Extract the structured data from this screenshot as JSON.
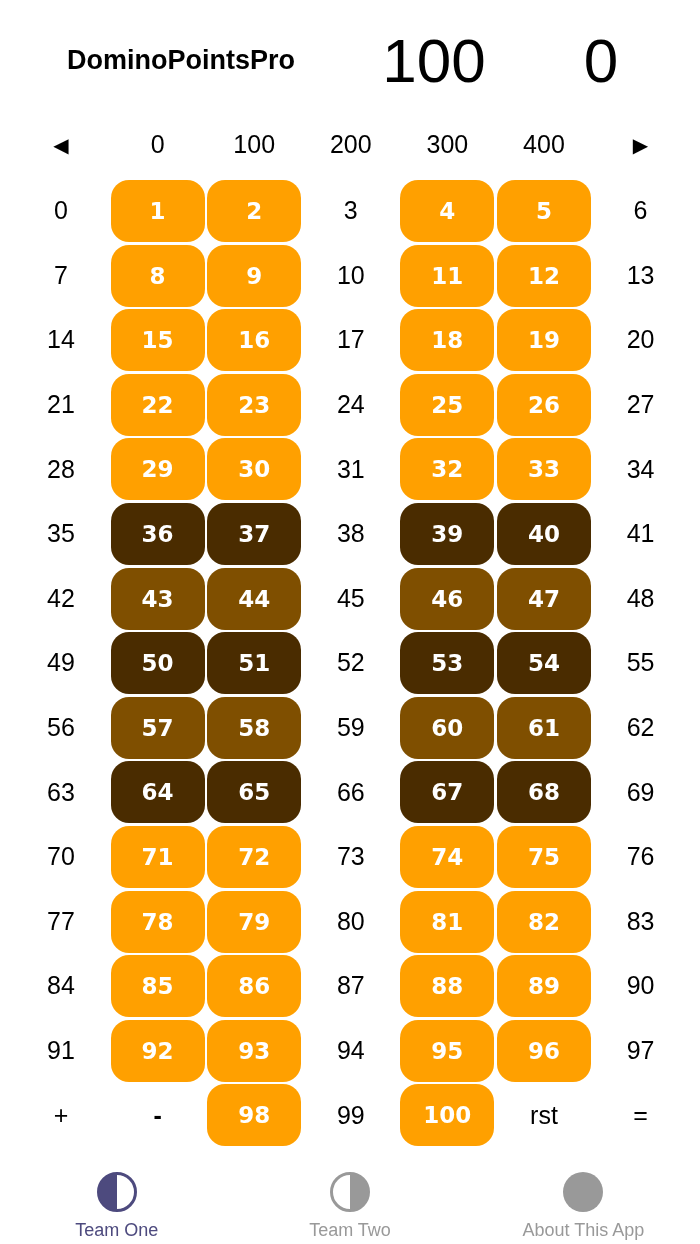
{
  "header": {
    "title": "DominoPointsPro",
    "scores": [
      "100",
      "0"
    ]
  },
  "top_row": [
    {
      "label": "◀",
      "kind": "arrow"
    },
    {
      "label": "0",
      "kind": "plain"
    },
    {
      "label": "100",
      "kind": "plain"
    },
    {
      "label": "200",
      "kind": "plain"
    },
    {
      "label": "300",
      "kind": "plain"
    },
    {
      "label": "400",
      "kind": "plain"
    },
    {
      "label": "▶",
      "kind": "arrow"
    }
  ],
  "grid": {
    "rows": [
      {
        "cells": [
          {
            "label": "0",
            "kind": "plain"
          },
          {
            "label": "1",
            "kind": "tile",
            "color": "#ffa000"
          },
          {
            "label": "2",
            "kind": "tile",
            "color": "#ffa000"
          },
          {
            "label": "3",
            "kind": "plain"
          },
          {
            "label": "4",
            "kind": "tile",
            "color": "#ffa000"
          },
          {
            "label": "5",
            "kind": "tile",
            "color": "#ffa000"
          },
          {
            "label": "6",
            "kind": "plain"
          }
        ]
      },
      {
        "cells": [
          {
            "label": "7",
            "kind": "plain"
          },
          {
            "label": "8",
            "kind": "tile",
            "color": "#ffa000"
          },
          {
            "label": "9",
            "kind": "tile",
            "color": "#ffa000"
          },
          {
            "label": "10",
            "kind": "plain"
          },
          {
            "label": "11",
            "kind": "tile",
            "color": "#ffa000"
          },
          {
            "label": "12",
            "kind": "tile",
            "color": "#ffa000"
          },
          {
            "label": "13",
            "kind": "plain"
          }
        ]
      },
      {
        "cells": [
          {
            "label": "14",
            "kind": "plain"
          },
          {
            "label": "15",
            "kind": "tile",
            "color": "#ffa000"
          },
          {
            "label": "16",
            "kind": "tile",
            "color": "#ffa000"
          },
          {
            "label": "17",
            "kind": "plain"
          },
          {
            "label": "18",
            "kind": "tile",
            "color": "#ffa000"
          },
          {
            "label": "19",
            "kind": "tile",
            "color": "#ffa000"
          },
          {
            "label": "20",
            "kind": "plain"
          }
        ]
      },
      {
        "cells": [
          {
            "label": "21",
            "kind": "plain"
          },
          {
            "label": "22",
            "kind": "tile",
            "color": "#ffa000"
          },
          {
            "label": "23",
            "kind": "tile",
            "color": "#ffa000"
          },
          {
            "label": "24",
            "kind": "plain"
          },
          {
            "label": "25",
            "kind": "tile",
            "color": "#ffa000"
          },
          {
            "label": "26",
            "kind": "tile",
            "color": "#ffa000"
          },
          {
            "label": "27",
            "kind": "plain"
          }
        ]
      },
      {
        "cells": [
          {
            "label": "28",
            "kind": "plain"
          },
          {
            "label": "29",
            "kind": "tile",
            "color": "#ffa000"
          },
          {
            "label": "30",
            "kind": "tile",
            "color": "#ffa000"
          },
          {
            "label": "31",
            "kind": "plain"
          },
          {
            "label": "32",
            "kind": "tile",
            "color": "#ffa000"
          },
          {
            "label": "33",
            "kind": "tile",
            "color": "#ffa000"
          },
          {
            "label": "34",
            "kind": "plain"
          }
        ]
      },
      {
        "cells": [
          {
            "label": "35",
            "kind": "plain"
          },
          {
            "label": "36",
            "kind": "tile",
            "color": "#4a2c00"
          },
          {
            "label": "37",
            "kind": "tile",
            "color": "#4a2c00"
          },
          {
            "label": "38",
            "kind": "plain"
          },
          {
            "label": "39",
            "kind": "tile",
            "color": "#4a2c00"
          },
          {
            "label": "40",
            "kind": "tile",
            "color": "#4a2c00"
          },
          {
            "label": "41",
            "kind": "plain"
          }
        ]
      },
      {
        "cells": [
          {
            "label": "42",
            "kind": "plain"
          },
          {
            "label": "43",
            "kind": "tile",
            "color": "#7f4f00"
          },
          {
            "label": "44",
            "kind": "tile",
            "color": "#7f4f00"
          },
          {
            "label": "45",
            "kind": "plain"
          },
          {
            "label": "46",
            "kind": "tile",
            "color": "#7f4f00"
          },
          {
            "label": "47",
            "kind": "tile",
            "color": "#7f4f00"
          },
          {
            "label": "48",
            "kind": "plain"
          }
        ]
      },
      {
        "cells": [
          {
            "label": "49",
            "kind": "plain"
          },
          {
            "label": "50",
            "kind": "tile",
            "color": "#4a2c00"
          },
          {
            "label": "51",
            "kind": "tile",
            "color": "#4a2c00"
          },
          {
            "label": "52",
            "kind": "plain"
          },
          {
            "label": "53",
            "kind": "tile",
            "color": "#4a2c00"
          },
          {
            "label": "54",
            "kind": "tile",
            "color": "#4a2c00"
          },
          {
            "label": "55",
            "kind": "plain"
          }
        ]
      },
      {
        "cells": [
          {
            "label": "56",
            "kind": "plain"
          },
          {
            "label": "57",
            "kind": "tile",
            "color": "#7f4f00"
          },
          {
            "label": "58",
            "kind": "tile",
            "color": "#7f4f00"
          },
          {
            "label": "59",
            "kind": "plain"
          },
          {
            "label": "60",
            "kind": "tile",
            "color": "#7f4f00"
          },
          {
            "label": "61",
            "kind": "tile",
            "color": "#7f4f00"
          },
          {
            "label": "62",
            "kind": "plain"
          }
        ]
      },
      {
        "cells": [
          {
            "label": "63",
            "kind": "plain"
          },
          {
            "label": "64",
            "kind": "tile",
            "color": "#4a2c00"
          },
          {
            "label": "65",
            "kind": "tile",
            "color": "#4a2c00"
          },
          {
            "label": "66",
            "kind": "plain"
          },
          {
            "label": "67",
            "kind": "tile",
            "color": "#4a2c00"
          },
          {
            "label": "68",
            "kind": "tile",
            "color": "#4a2c00"
          },
          {
            "label": "69",
            "kind": "plain"
          }
        ]
      },
      {
        "cells": [
          {
            "label": "70",
            "kind": "plain"
          },
          {
            "label": "71",
            "kind": "tile",
            "color": "#ffa000"
          },
          {
            "label": "72",
            "kind": "tile",
            "color": "#ffa000"
          },
          {
            "label": "73",
            "kind": "plain"
          },
          {
            "label": "74",
            "kind": "tile",
            "color": "#ffa000"
          },
          {
            "label": "75",
            "kind": "tile",
            "color": "#ffa000"
          },
          {
            "label": "76",
            "kind": "plain"
          }
        ]
      },
      {
        "cells": [
          {
            "label": "77",
            "kind": "plain"
          },
          {
            "label": "78",
            "kind": "tile",
            "color": "#ffa000"
          },
          {
            "label": "79",
            "kind": "tile",
            "color": "#ffa000"
          },
          {
            "label": "80",
            "kind": "plain"
          },
          {
            "label": "81",
            "kind": "tile",
            "color": "#ffa000"
          },
          {
            "label": "82",
            "kind": "tile",
            "color": "#ffa000"
          },
          {
            "label": "83",
            "kind": "plain"
          }
        ]
      },
      {
        "cells": [
          {
            "label": "84",
            "kind": "plain"
          },
          {
            "label": "85",
            "kind": "tile",
            "color": "#ffa000"
          },
          {
            "label": "86",
            "kind": "tile",
            "color": "#ffa000"
          },
          {
            "label": "87",
            "kind": "plain"
          },
          {
            "label": "88",
            "kind": "tile",
            "color": "#ffa000"
          },
          {
            "label": "89",
            "kind": "tile",
            "color": "#ffa000"
          },
          {
            "label": "90",
            "kind": "plain"
          }
        ]
      },
      {
        "cells": [
          {
            "label": "91",
            "kind": "plain"
          },
          {
            "label": "92",
            "kind": "tile",
            "color": "#ffa000"
          },
          {
            "label": "93",
            "kind": "tile",
            "color": "#ffa000"
          },
          {
            "label": "94",
            "kind": "plain"
          },
          {
            "label": "95",
            "kind": "tile",
            "color": "#ffa000"
          },
          {
            "label": "96",
            "kind": "tile",
            "color": "#ffa000"
          },
          {
            "label": "97",
            "kind": "plain"
          }
        ]
      },
      {
        "cells": [
          {
            "label": "+",
            "kind": "plain"
          },
          {
            "label": "-",
            "kind": "bold"
          },
          {
            "label": "98",
            "kind": "tile",
            "color": "#ffa000"
          },
          {
            "label": "99",
            "kind": "plain"
          },
          {
            "label": "100",
            "kind": "tile",
            "color": "#ffa000"
          },
          {
            "label": "rst",
            "kind": "plain"
          },
          {
            "label": "=",
            "kind": "plain"
          }
        ]
      }
    ]
  },
  "tabs": [
    {
      "label": "Team One",
      "kind": "left-half",
      "selected": true
    },
    {
      "label": "Team Two",
      "kind": "right-half",
      "selected": false
    },
    {
      "label": "About This App",
      "kind": "full",
      "selected": false
    }
  ]
}
